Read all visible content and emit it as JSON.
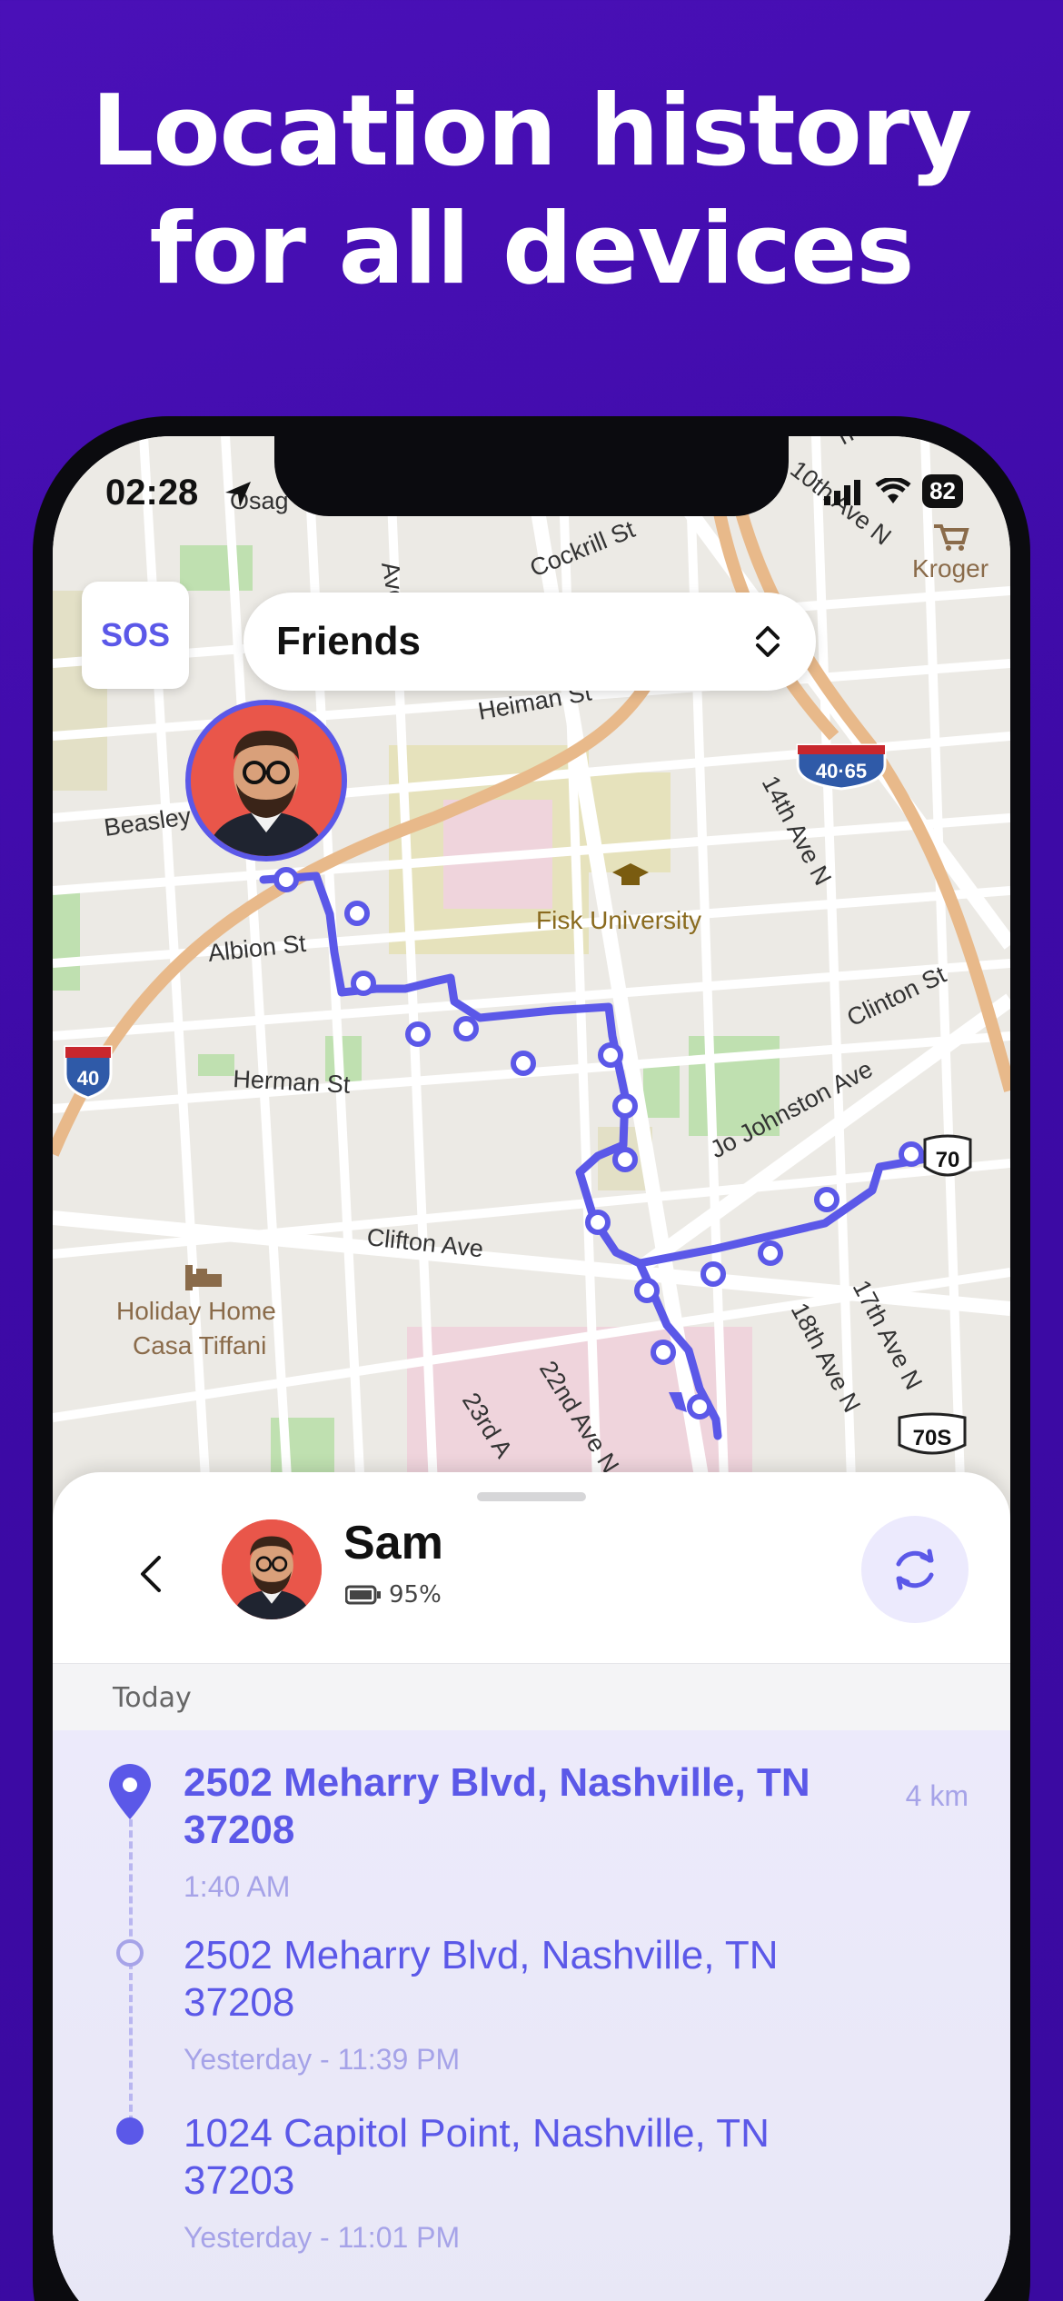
{
  "headline": {
    "line1": "Location history",
    "line2": "for all devices"
  },
  "status_bar": {
    "time": "02:28",
    "battery": "82"
  },
  "map": {
    "sos_label": "SOS",
    "group_selector": "Friends",
    "labels": {
      "kroger": "Kroger",
      "cockrill": "Cockrill St",
      "heiman": "Heiman St",
      "beasley": "Beasley",
      "albion": "Albion St",
      "herman": "Herman St",
      "fisk": "Fisk University",
      "ave14": "14th Ave N",
      "clinton": "Clinton St",
      "jojohnston": "Jo Johnston Ave",
      "clifton": "Clifton Ave",
      "holiday1": "Holiday Home",
      "holiday2": "Casa Tiffani",
      "ave18": "18th Ave N",
      "ave17": "17th Ave N",
      "ave22": "22nd Ave N",
      "ave23": "23rd A",
      "shield_i40": "40",
      "shield_i4065": "40·65",
      "shield_us70": "70",
      "shield_70s": "70S",
      "ave_top": "Ave N",
      "osag": "Osag",
      "ave10": "10th Ave N",
      "ave_top_right": "h Ave N"
    }
  },
  "sheet": {
    "user_name": "Sam",
    "battery_percent": "95%",
    "day_header": "Today",
    "history": [
      {
        "address": "2502 Meharry Blvd, Nashville, TN 37208",
        "time": "1:40 AM",
        "distance": "4 km"
      },
      {
        "address": "2502 Meharry Blvd, Nashville, TN 37208",
        "time": "Yesterday - 11:39 PM"
      },
      {
        "address": "1024 Capitol Point, Nashville, TN 37203",
        "time": "Yesterday - 11:01 PM"
      }
    ]
  },
  "colors": {
    "accent": "#5b58e8",
    "background": "#3d0aa6",
    "route": "#5b58e8"
  },
  "icons": [
    "location-arrow-icon",
    "signal-icon",
    "wifi-icon",
    "chevron-updown-icon",
    "chevron-left-icon",
    "battery-icon",
    "refresh-icon",
    "pin-icon",
    "graduation-cap-icon",
    "bed-icon",
    "cart-icon"
  ]
}
